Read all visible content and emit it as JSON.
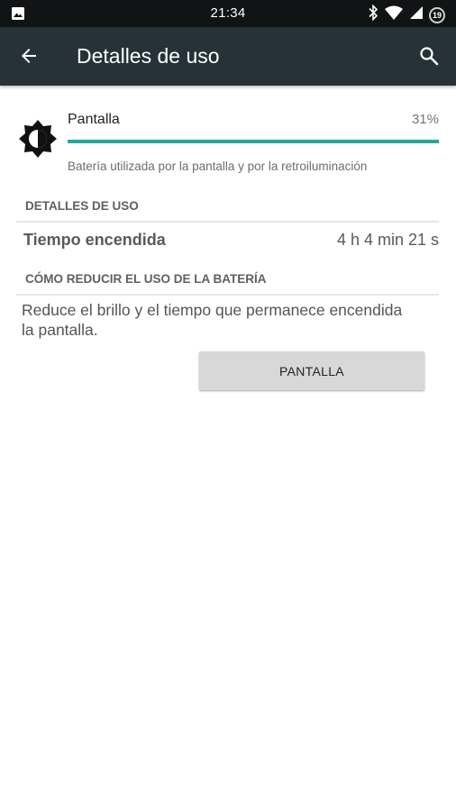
{
  "status_bar": {
    "time": "21:34",
    "battery_level": "19",
    "icons": [
      "image-icon",
      "bluetooth-icon",
      "wifi-icon",
      "cell-signal-icon",
      "battery-icon"
    ]
  },
  "app_bar": {
    "title": "Detalles de uso",
    "back_icon": "arrow-back-icon",
    "search_icon": "search-icon",
    "background_color": "#263238"
  },
  "usage": {
    "item_label": "Pantalla",
    "percent_text": "31%",
    "percent_value": 0.31,
    "bar_color": "#26a69a",
    "summary": "Batería utilizada por la pantalla y por la retroiluminación",
    "icon": "brightness-icon"
  },
  "sections": {
    "details_header": "DETALLES DE USO",
    "reduce_header": "CÓMO REDUCIR EL USO DE LA BATERÍA"
  },
  "details": {
    "time_on_label": "Tiempo encendida",
    "time_on_value": "4 h 4 min 21 s"
  },
  "tip": {
    "text": "Reduce el brillo y el tiempo que permanece encendida la pantalla.",
    "button_label": "PANTALLA"
  }
}
